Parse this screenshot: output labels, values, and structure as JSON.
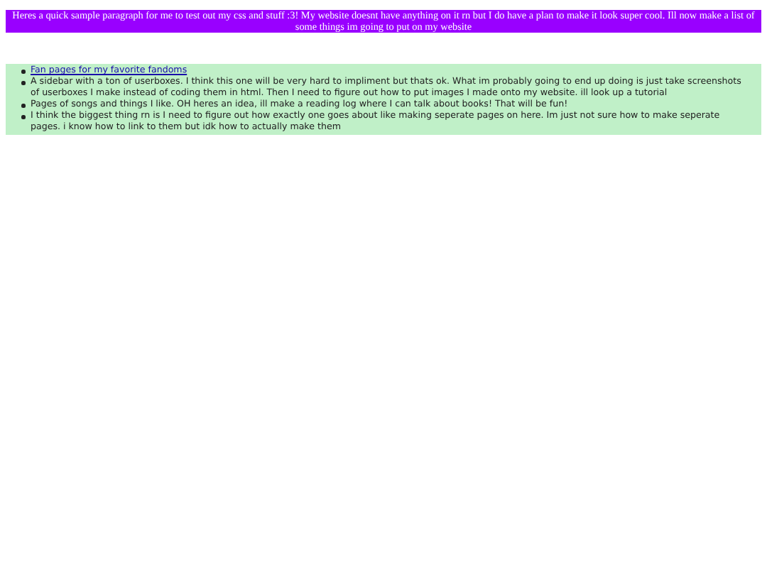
{
  "header": {
    "text": "Heres a quick sample paragraph for me to test out my css and stuff :3! My website doesnt have anything on it rn but I do have a plan to make it look super cool. Ill now make a list of some things im going to put on my website"
  },
  "list": [
    {
      "kind": "link",
      "text": "Fan pages for my favorite fandoms"
    },
    {
      "kind": "text",
      "text": "A sidebar with a ton of userboxes. I think this one will be very hard to impliment but thats ok. What im probably going to end up doing is just take screenshots of userboxes I make instead of coding them in html. Then I need to figure out how to put images I made onto my website. ill look up a tutorial"
    },
    {
      "kind": "text",
      "text": "Pages of songs and things I like. OH heres an idea, ill make a reading log where I can talk about books! That will be fun!"
    },
    {
      "kind": "text",
      "text": "I think the biggest thing rn is I need to figure out how exactly one goes about like making seperate pages on here. Im just not sure how to make seperate pages. i know how to link to them but idk how to actually make them"
    }
  ]
}
